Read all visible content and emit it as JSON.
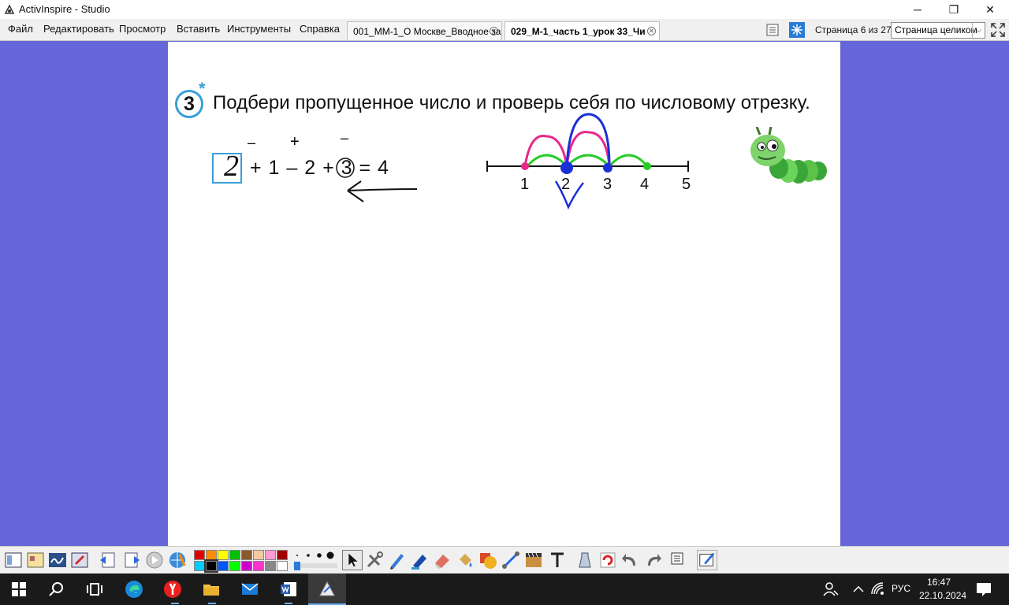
{
  "window": {
    "title": "ActivInspire - Studio",
    "minimize": "─",
    "restore": "❐",
    "close": "✕"
  },
  "menu": [
    "Файл",
    "Редактировать",
    "Просмотр",
    "Вставить",
    "Инструменты",
    "Справка"
  ],
  "tabs": [
    {
      "label": "001_ММ-1_О Москве_Вводное зан",
      "active": false
    },
    {
      "label": "029_М-1_часть 1_урок 33_Чи",
      "active": true
    }
  ],
  "page_indicator": "Страница 6 из 27",
  "zoom": {
    "selected": "Страница целиком"
  },
  "task": {
    "number": "3",
    "star": "*",
    "text": "Подбери пропущенное число и проверь себя по числовому отрезку.",
    "answer_digit": "2",
    "equation": "+ 1 – 2 + 3 = 4",
    "handwritten_marks": [
      "–",
      "+",
      "–"
    ]
  },
  "number_line": {
    "labels": [
      "1",
      "2",
      "3",
      "4",
      "5"
    ],
    "colors": {
      "magenta": "#e8288c",
      "green": "#22cc22",
      "blue": "#1a2fd8"
    }
  },
  "palette": [
    "#e00000",
    "#ff8c00",
    "#ffff00",
    "#00c000",
    "#8b5a2b",
    "#f5c9a0",
    "#ff9ad5",
    "#a00000",
    "#00ccff",
    "#000000",
    "#0055ff",
    "#00ff00",
    "#cc00cc",
    "#ff33cc",
    "#888888",
    "#ffffff"
  ],
  "clock": {
    "time": "16:47",
    "date": "22.10.2024"
  },
  "language": "РУС"
}
